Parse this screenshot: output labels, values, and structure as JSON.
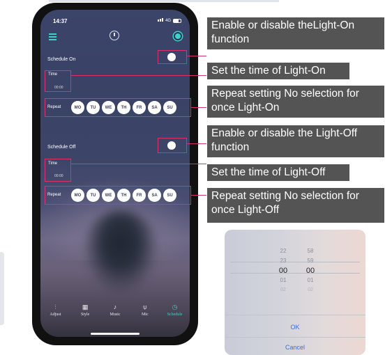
{
  "status": {
    "time": "14:37",
    "network": "4G"
  },
  "schedule_on": {
    "label": "Schedule On",
    "time_label": "Time",
    "time_value": "00:00",
    "repeat_label": "Repeat"
  },
  "schedule_off": {
    "label": "Schedule Off",
    "time_label": "Time",
    "time_value": "00:00",
    "repeat_label": "Repeat"
  },
  "days": [
    "MO",
    "TU",
    "WE",
    "TH",
    "FR",
    "SA",
    "SU"
  ],
  "tabs": [
    {
      "label": "Adjust",
      "icon": "sliders-icon"
    },
    {
      "label": "Style",
      "icon": "grid-icon"
    },
    {
      "label": "Music",
      "icon": "music-note-icon"
    },
    {
      "label": "Mic",
      "icon": "mic-icon"
    },
    {
      "label": "Schedule",
      "icon": "timer-icon"
    }
  ],
  "callouts": {
    "on_toggle": "Enable or disable theLight-On function",
    "on_time": "Set the time of Light-On",
    "on_repeat": "Repeat setting No selection for once Light-On",
    "off_toggle": "Enable or disable the Light-Off function",
    "off_time": "Set the time of Light-Off",
    "off_repeat": "Repeat setting No selection for once Light-Off"
  },
  "picker": {
    "hours": [
      "",
      "22",
      "23",
      "00",
      "01",
      "02",
      ""
    ],
    "minutes": [
      "",
      "58",
      "59",
      "00",
      "01",
      "02",
      ""
    ],
    "ok_label": "OK",
    "cancel_label": "Cancel"
  },
  "colors": {
    "accent": "#3fd0c6",
    "highlight": "#d8336a",
    "callout_bg": "#545454"
  }
}
